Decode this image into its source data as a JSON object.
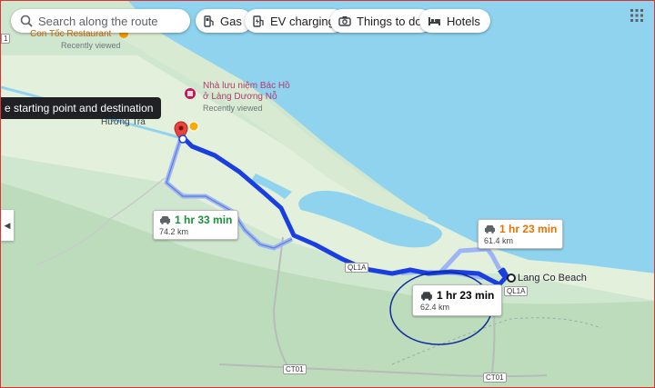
{
  "search": {
    "placeholder": "Search along the route"
  },
  "filters": [
    {
      "label": "Gas",
      "icon": "gas-station-icon"
    },
    {
      "label": "EV charging",
      "icon": "ev-charging-icon"
    },
    {
      "label": "Things to do",
      "icon": "camera-icon"
    },
    {
      "label": "Hotels",
      "icon": "bed-icon"
    }
  ],
  "tooltip": "e starting point and destination",
  "routes": [
    {
      "time": "1 hr 33 min",
      "distance": "74.2 km",
      "time_color": "#1e8e3e"
    },
    {
      "time": "1 hr 23 min",
      "distance": "61.4 km",
      "time_color": "#e37400"
    },
    {
      "time": "1 hr 23 min",
      "distance": "62.4 km",
      "time_color": "#202124",
      "selected": true
    }
  ],
  "places": {
    "restaurant_name": "Con Tốc Restaurant",
    "restaurant_note": "Recently viewed",
    "museum_name_line1": "Nhà lưu niệm Bác Hồ",
    "museum_name_line2": "ở Làng Dương Nỗ",
    "museum_note": "Recently viewed",
    "town": "Hương Trà",
    "destination": "Lang Co Beach"
  },
  "road_shields": {
    "ql1a_1": "QL1A",
    "ql1a_2": "QL1A",
    "ct01_1": "CT01",
    "ct01_2": "CT01",
    "left_marker": "1"
  },
  "colors": {
    "land": "#cfe6cf",
    "water": "#8fd3ee",
    "selected_route": "#1a3fe0",
    "alt_route": "#9db5f5",
    "annotation_circle": "#102a9e",
    "start_pin": "#e8453c"
  }
}
